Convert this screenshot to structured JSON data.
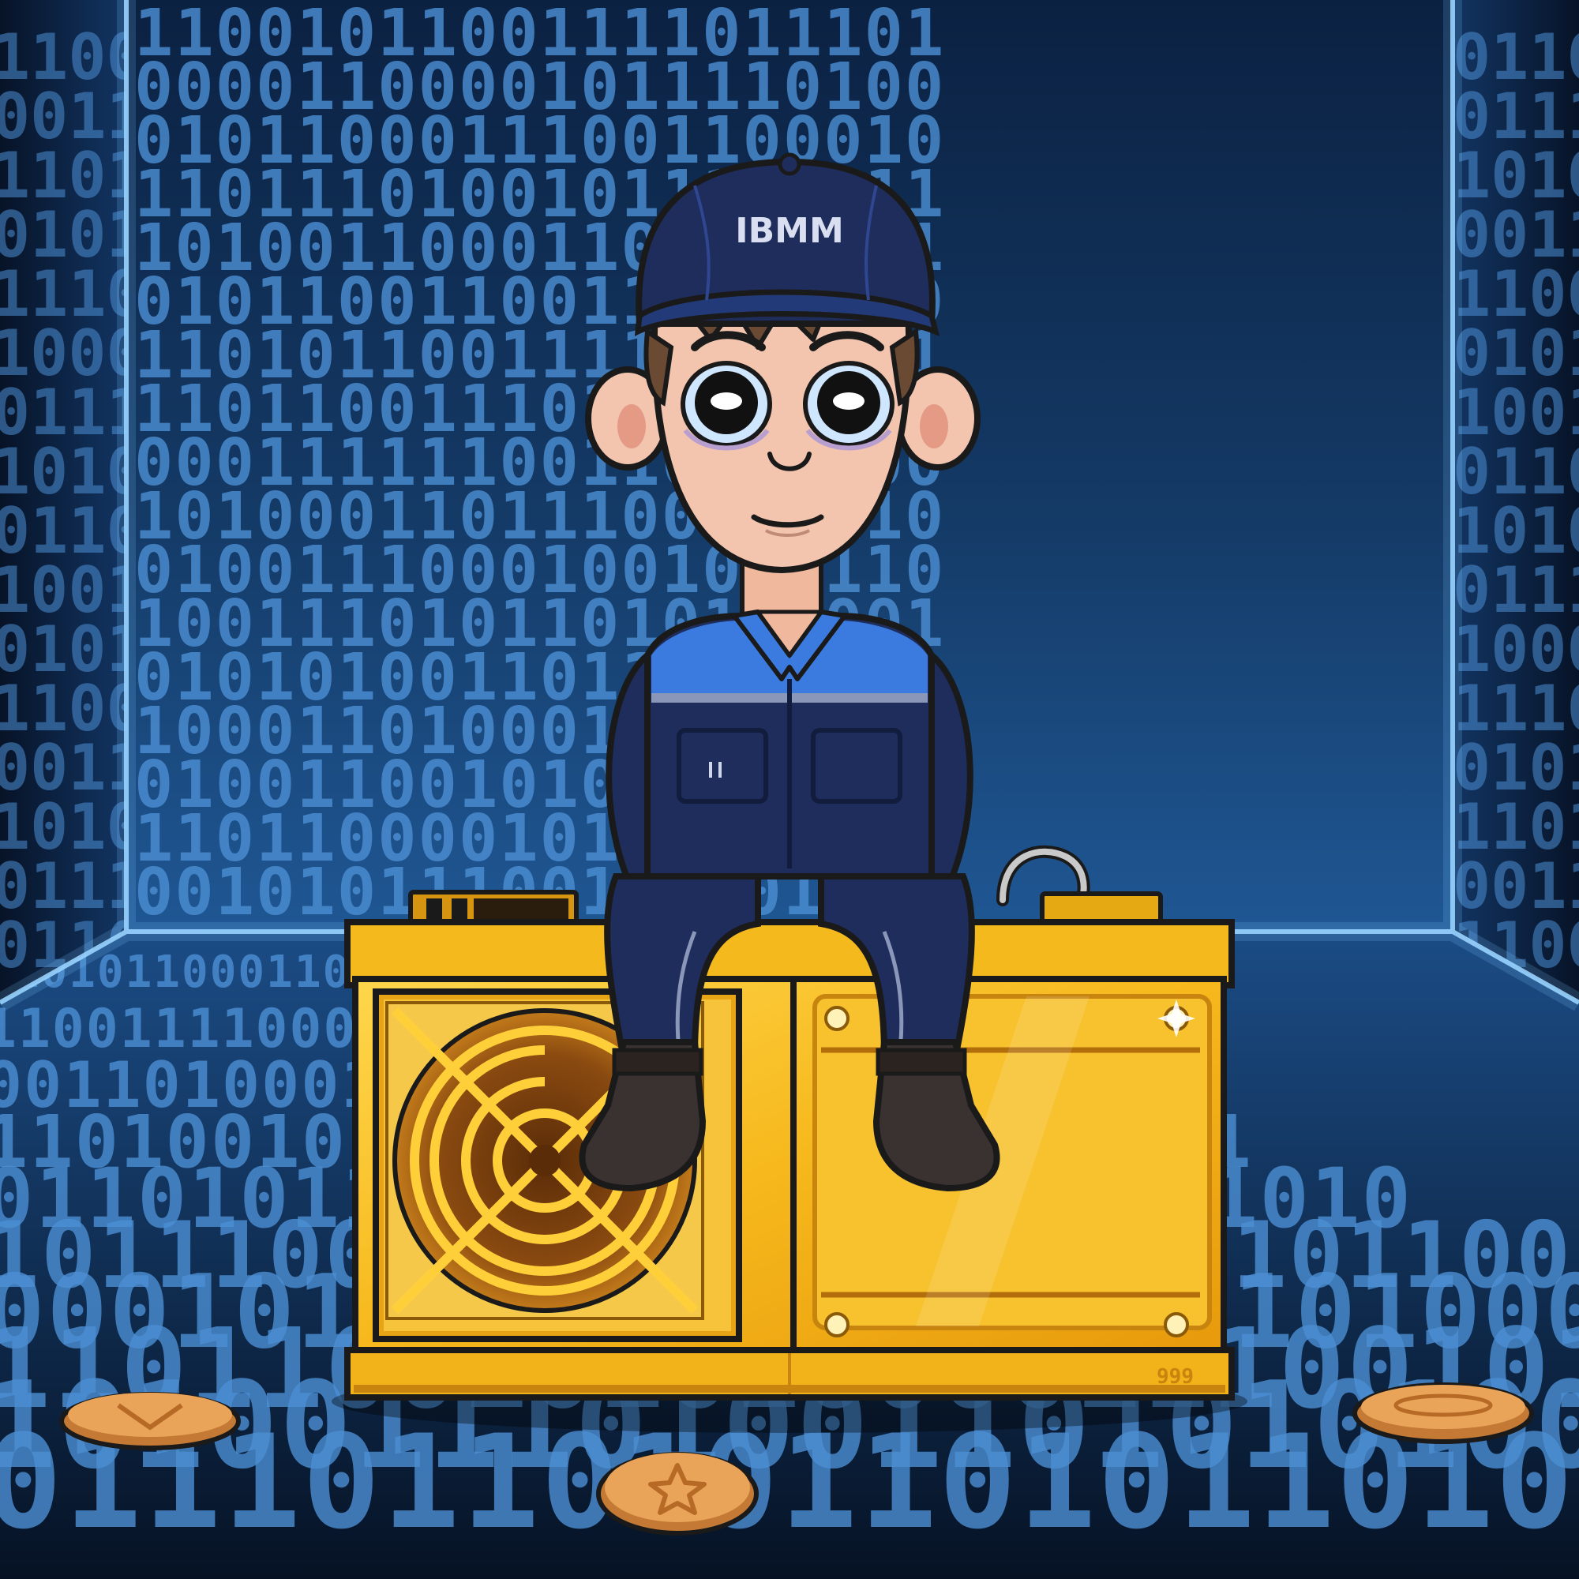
{
  "cap_logo": "IBMM",
  "miner_serial": "999",
  "back_wall_rows": [
    "11001011001111011101",
    "00001100001011110100",
    "01011000111001100010",
    "11011101001011101011",
    "10100110001101011111",
    "01011001100110001000",
    "11010110011110001011",
    "11011001110110010101",
    "00011111100110110100",
    "10100011011100101110",
    "01001110001001011110",
    "10011101011010111001",
    "01010100110111000101",
    "10001101000110010100",
    "01001100101000001011",
    "11011000010111011100",
    "00101011100111101000"
  ],
  "side_wall_rows": [
    "1100",
    "0011",
    "1101",
    "0101",
    "1110",
    "1000",
    "0111",
    "1010",
    "0110",
    "1001",
    "0101",
    "1100",
    "0011",
    "1010",
    "0111",
    "0110"
  ],
  "floor_rows": [
    "0101011000110011001000101011",
    "1100111100010100011101001101",
    "0011010001110011001011010011",
    "1101001011101011001101100101",
    "0110101100010100110100011010",
    "1011100100111010001011101100",
    "0001011101001011110010100011",
    "1101100101010000111001011011",
    "1010011101001101010100101001",
    "0111011010110101101010110111"
  ],
  "colors": {
    "wall": "#0f2a4f",
    "digit": "#4c8fd4",
    "glow": "#7ec6ff",
    "uniform": "#1f2d5c",
    "uniform_accent": "#3b7be0",
    "skin": "#f3c5ae",
    "hair": "#6b4a33",
    "gold": "#f2b21a",
    "gold_light": "#ffd54a",
    "gold_dark": "#b5730c",
    "boots": "#3a3230",
    "coin": "#e9a45a"
  }
}
